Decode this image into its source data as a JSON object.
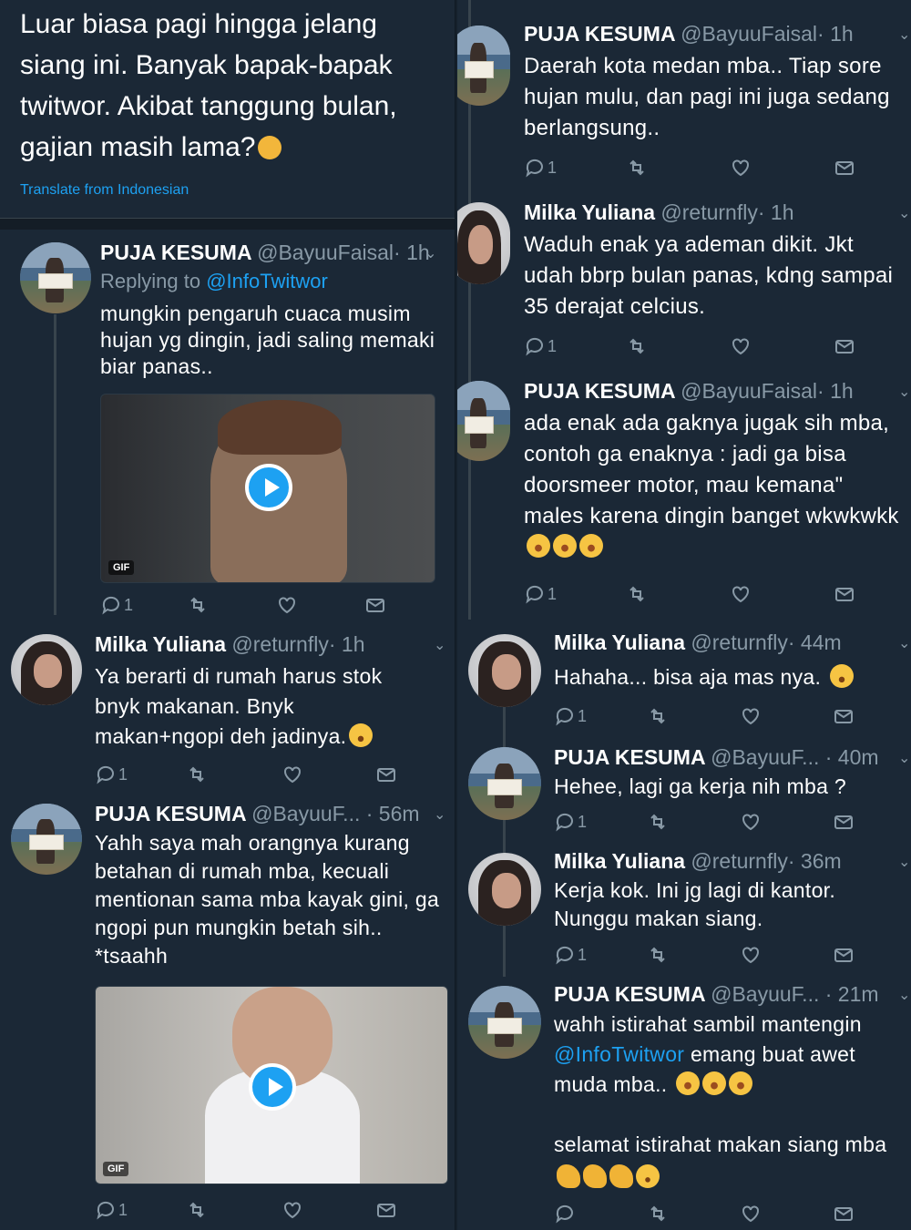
{
  "intro": {
    "text": "Luar biasa pagi hingga jelang siang ini. Banyak bapak-bapak twitwor. Akibat tanggung bulan, gajian masih lama?",
    "translate": "Translate from Indonesian"
  },
  "left": {
    "t1": {
      "name": "PUJA KESUMA",
      "handle": "@BayuuFaisal",
      "time": "· 1h",
      "replying_prefix": "Replying to ",
      "replying_to": "@InfoTwitwor",
      "body": "mungkin pengaruh cuaca musim hujan yg dingin, jadi saling memaki biar panas..",
      "media_badge": "GIF",
      "reply_count": "1"
    },
    "t2": {
      "name": "Milka Yuliana",
      "handle": "@returnfly",
      "time": "· 1h",
      "body": "Ya berarti di rumah harus stok bnyk makanan. Bnyk makan+ngopi deh jadinya.",
      "reply_count": "1"
    },
    "t3": {
      "name": "PUJA KESUMA",
      "handle": "@BayuuF...",
      "time": "· 56m",
      "body": "Yahh saya mah orangnya kurang betahan di rumah mba, kecuali mentionan sama mba kayak gini, ga ngopi pun mungkin betah sih.. *tsaahh",
      "media_badge": "GIF",
      "reply_count": "1"
    }
  },
  "right": {
    "t1": {
      "name": "PUJA KESUMA",
      "handle": "@BayuuFaisal",
      "time": "· 1h",
      "body": "Daerah kota medan mba.. Tiap sore hujan mulu, dan pagi ini juga sedang berlangsung..",
      "reply_count": "1"
    },
    "t2": {
      "name": "Milka Yuliana",
      "handle": "@returnfly",
      "time": "· 1h",
      "body": "Waduh enak ya ademan dikit. Jkt udah bbrp bulan panas, kdng sampai 35 derajat celcius.",
      "reply_count": "1"
    },
    "t3": {
      "name": "PUJA KESUMA",
      "handle": "@BayuuFaisal",
      "time": "· 1h",
      "body": "ada enak ada gaknya jugak sih mba, contoh ga enaknya : jadi ga bisa doorsmeer motor, mau kemana\" males karena dingin banget wkwkwkk",
      "reply_count": "1"
    },
    "t4": {
      "name": "Milka Yuliana",
      "handle": "@returnfly",
      "time": "· 44m",
      "body": "Hahaha... bisa aja mas nya.",
      "reply_count": "1"
    },
    "t5": {
      "name": "PUJA KESUMA",
      "handle": "@BayuuF...",
      "time": "· 40m",
      "body": "Hehee, lagi ga kerja nih mba ?",
      "reply_count": "1"
    },
    "t6": {
      "name": "Milka Yuliana",
      "handle": "@returnfly",
      "time": "· 36m",
      "body": "Kerja kok. Ini jg lagi di kantor. Nunggu makan siang.",
      "reply_count": "1"
    },
    "t7": {
      "name": "PUJA KESUMA",
      "handle": "@BayuuF...",
      "time": "· 21m",
      "body_prefix": "wahh istirahat sambil mantengin ",
      "mention": "@InfoTwitwor",
      "body_suffix": " emang buat awet muda mba..",
      "body_second": "selamat istirahat makan siang mba"
    }
  },
  "colors": {
    "background": "#1b2836",
    "link": "#1da1f2",
    "muted": "#8899a6"
  },
  "icons": [
    "reply-icon",
    "retweet-icon",
    "like-icon",
    "message-icon",
    "play-icon",
    "chevron-down-icon"
  ]
}
